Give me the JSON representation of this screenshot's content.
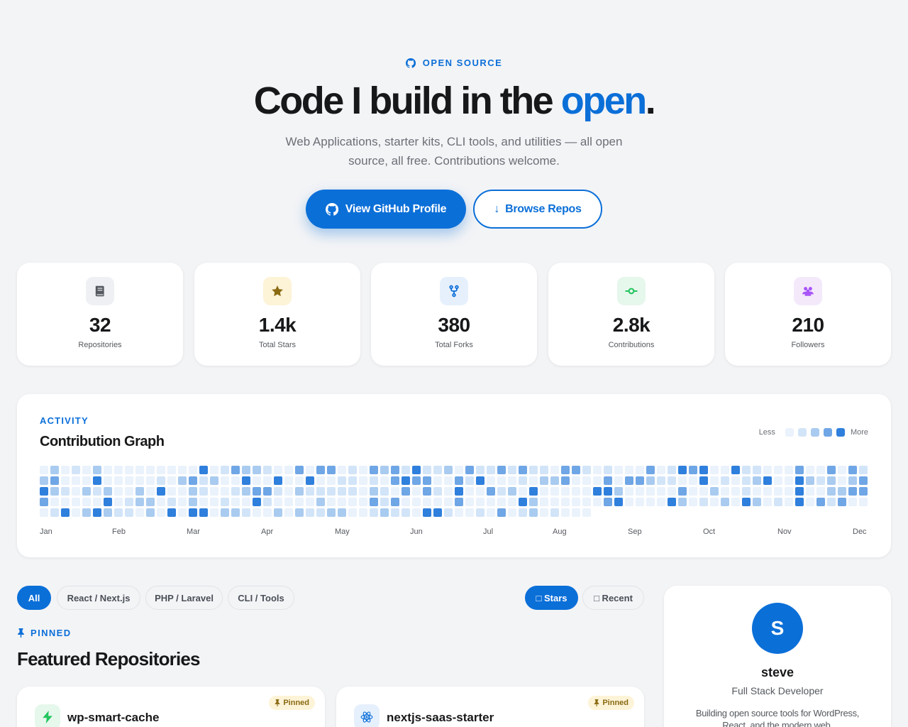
{
  "hero": {
    "eyebrow": "OPEN SOURCE",
    "headline_part1": "Code I build in the ",
    "headline_accent": "open",
    "headline_end": ".",
    "subtitle": "Web Applications, starter kits, CLI tools, and utilities — all open source, all free. Contributions welcome.",
    "primary_button": "View GitHub Profile",
    "secondary_button": "Browse Repos"
  },
  "stats": [
    {
      "value": "32",
      "label": "Repositories",
      "icon": "book-icon",
      "icon_bg": "#eef0f3",
      "icon_color": "#55595f"
    },
    {
      "value": "1.4k",
      "label": "Total Stars",
      "icon": "star-icon",
      "icon_bg": "#fdf3d7",
      "icon_color": "#8a6a12"
    },
    {
      "value": "380",
      "label": "Total Forks",
      "icon": "fork-icon",
      "icon_bg": "#e6f0fc",
      "icon_color": "#0b6fd8"
    },
    {
      "value": "2.8k",
      "label": "Contributions",
      "icon": "commit-icon",
      "icon_bg": "#e6f7ec",
      "icon_color": "#22c55e"
    },
    {
      "value": "210",
      "label": "Followers",
      "icon": "users-icon",
      "icon_bg": "#f4e9fb",
      "icon_color": "#a855f7"
    }
  ],
  "activity": {
    "eyebrow": "ACTIVITY",
    "title": "Contribution Graph",
    "legend_less": "Less",
    "legend_more": "More",
    "level_colors": [
      "#eaf2fc",
      "#d2e4f8",
      "#a9cbf0",
      "#6fa6e6",
      "#2f7fdd"
    ],
    "months": [
      "Jan",
      "Feb",
      "Mar",
      "Apr",
      "May",
      "Jun",
      "Jul",
      "Aug",
      "Sep",
      "Oct",
      "Nov",
      "Dec"
    ],
    "weeks": 78,
    "rows": 5
  },
  "filters": {
    "categories": [
      "All",
      "React / Next.js",
      "PHP / Laravel",
      "CLI / Tools"
    ],
    "active_category": "All",
    "sort": [
      "⭐ Stars",
      "◷ Recent"
    ],
    "sort_display": [
      "□ Stars",
      "□ Recent"
    ]
  },
  "pinned": {
    "eyebrow": "PINNED",
    "title": "Featured Repositories",
    "badge": "Pinned",
    "repos": [
      {
        "name": "wp-smart-cache",
        "icon": "bolt-icon",
        "icon_bg": "#e6f7ec",
        "icon_color": "#22c55e"
      },
      {
        "name": "nextjs-saas-starter",
        "icon": "react-icon",
        "icon_bg": "#e6f0fc",
        "icon_color": "#0b6fd8"
      }
    ]
  },
  "profile": {
    "initial": "S",
    "name": "steve",
    "role": "Full Stack Developer",
    "bio": "Building open source tools for WordPress, React, and the modern web."
  }
}
